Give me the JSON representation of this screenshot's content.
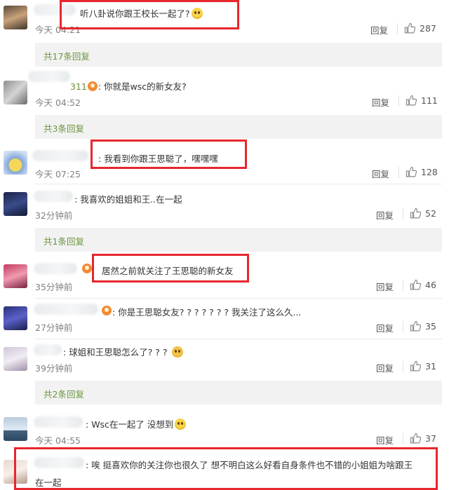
{
  "reply_label": "回复",
  "comments": [
    {
      "name_visible": "",
      "text": "听八卦说你跟王校长一起了?",
      "time": "今天 04:21",
      "likes": "287"
    },
    {
      "name_visible": "311",
      "text": "你就是wsc的新女友?",
      "time": "今天 04:52",
      "likes": "111"
    },
    {
      "name_visible": "",
      "text": "我看到你跟王思聪了，嘿嘿嘿",
      "time": "今天 07:25",
      "likes": "128"
    },
    {
      "name_visible": "",
      "text": "我喜欢的姐姐和王..在一起",
      "time": "32分钟前",
      "likes": "52"
    },
    {
      "name_visible": "",
      "text": "居然之前就关注了王思聪的新女友",
      "time": "35分钟前",
      "likes": "46"
    },
    {
      "name_visible": "",
      "text": "你是王思聪女友? ? ? ? ? ? ? 我关注了这么久...",
      "time": "27分钟前",
      "likes": "35"
    },
    {
      "name_visible": "",
      "text": "球姐和王思聪怎么了? ? ?",
      "time": "39分钟前",
      "likes": "31"
    },
    {
      "name_visible": "",
      "text": "Wsc在一起了  没想到",
      "time": "今天 04:55",
      "likes": "37"
    },
    {
      "name_visible": "",
      "text": "唉 挺喜欢你的关注你也很久了 想不明白这么好看自身条件也不错的小姐姐为啥跟王",
      "text2": "在一起",
      "time": "",
      "likes": ""
    }
  ],
  "sub_replies": [
    "共17条回复",
    "共3条回复",
    "共1条回复",
    "共2条回复"
  ],
  "colors": {
    "highlight": "#e8262e",
    "link_green": "#6c963f"
  }
}
